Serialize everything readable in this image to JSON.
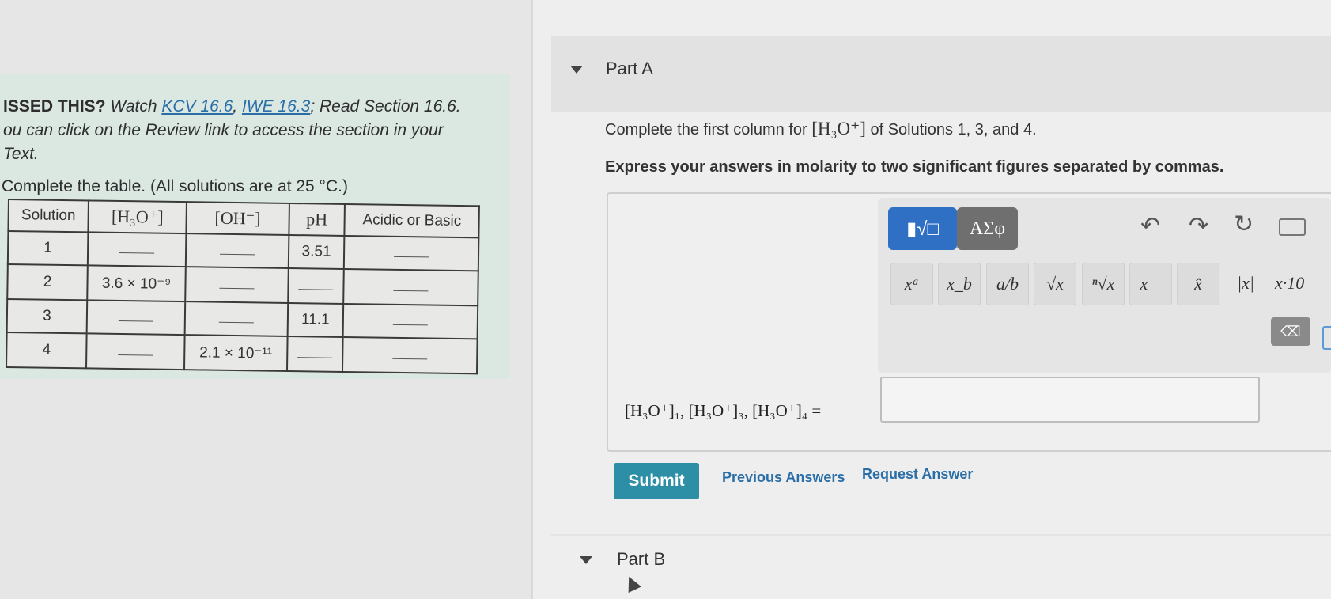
{
  "hint": {
    "heading": "ISSED THIS?",
    "watch": "Watch",
    "link1": "KCV 16.6",
    "sep": ",",
    "link2": "IWE 16.3",
    "read": "; Read Section 16.6.",
    "line2": "ou can click on the Review link to access the section in your",
    "line3": "Text."
  },
  "table_intro": "Complete the table. (All solutions are at 25 °C.)",
  "table": {
    "headers": [
      "Solution",
      "[H₃O⁺]",
      "[OH⁻]",
      "pH",
      "Acidic or Basic"
    ],
    "rows": [
      [
        "1",
        "",
        "",
        "3.51",
        ""
      ],
      [
        "2",
        "3.6 × 10⁻⁹",
        "",
        "",
        ""
      ],
      [
        "3",
        "",
        "",
        "11.1",
        ""
      ],
      [
        "4",
        "",
        "2.1 × 10⁻¹¹",
        "",
        ""
      ]
    ]
  },
  "part_a": {
    "title": "Part A",
    "question_pre": "Complete the first column for",
    "question_math": "[H₃O⁺]",
    "question_post": "of Solutions 1, 3, and 4.",
    "instruction": "Express your answers in molarity to two significant figures separated by commas.",
    "equation_label": "[H₃O⁺]₁, [H₃O⁺]₃, [H₃O⁺]₄ =",
    "answer_value": "",
    "toolbar": {
      "template_label": "▮√□",
      "symbols_label": "ΑΣφ",
      "undo": "↶",
      "redo": "↷",
      "reset": "↻",
      "buttons": [
        "xᵃ",
        "x_b",
        "a/b",
        "√x",
        "ⁿ√x",
        "x⃗",
        "x̂",
        "|x|",
        "x·10"
      ],
      "backspace": "⌫"
    },
    "submit": "Submit",
    "previous_answers": "Previous Answers",
    "request_answer": "Request Answer"
  },
  "part_b": {
    "title": "Part B"
  },
  "icons": [
    "expand-triangle-icon",
    "undo-icon",
    "redo-icon",
    "reset-icon",
    "keyboard-icon",
    "backspace-icon",
    "mouse-cursor-icon"
  ],
  "colors": {
    "template_btn": "#2f6fc4",
    "symbols_btn": "#6f6f6f",
    "submit_btn": "#2c8fa6",
    "link": "#2a6ea8",
    "hint_bg": "#dbe8e2"
  }
}
